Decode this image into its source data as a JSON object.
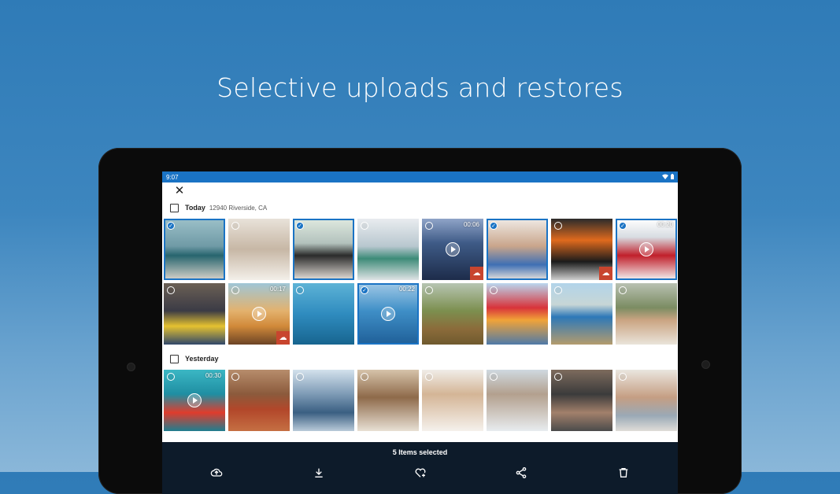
{
  "headline": "Selective uploads and restores",
  "status": {
    "time": "9:07"
  },
  "sections": {
    "today": {
      "title": "Today",
      "subtitle": "12940 Riverside, CA"
    },
    "yesterday": {
      "title": "Yesterday"
    }
  },
  "today_items": [
    {
      "selected": true,
      "duration": ""
    },
    {
      "selected": false,
      "duration": ""
    },
    {
      "selected": true,
      "duration": ""
    },
    {
      "selected": false,
      "duration": ""
    },
    {
      "selected": false,
      "duration": "00:06",
      "cloud_off": true
    },
    {
      "selected": true,
      "duration": ""
    },
    {
      "selected": false,
      "duration": "",
      "cloud_off": true
    },
    {
      "selected": true,
      "duration": "00:20"
    },
    {
      "selected": false,
      "duration": ""
    },
    {
      "selected": false,
      "duration": "00:17",
      "cloud_off": true
    },
    {
      "selected": false,
      "duration": ""
    },
    {
      "selected": true,
      "duration": "00:22"
    },
    {
      "selected": false,
      "duration": ""
    },
    {
      "selected": false,
      "duration": ""
    },
    {
      "selected": false,
      "duration": ""
    },
    {
      "selected": false,
      "duration": ""
    }
  ],
  "yesterday_items": [
    {
      "selected": false,
      "duration": "00:30"
    },
    {
      "selected": false,
      "duration": ""
    },
    {
      "selected": false,
      "duration": ""
    },
    {
      "selected": false,
      "duration": ""
    },
    {
      "selected": false,
      "duration": ""
    },
    {
      "selected": false,
      "duration": ""
    },
    {
      "selected": false,
      "duration": ""
    },
    {
      "selected": false,
      "duration": ""
    }
  ],
  "bottom": {
    "selection_text": "5 Items selected"
  },
  "icons": {
    "close": "close-icon",
    "upload": "cloud-upload-icon",
    "download": "download-icon",
    "favorite": "heart-plus-icon",
    "share": "share-icon",
    "delete": "trash-icon"
  },
  "colors": {
    "accent": "#1a73c4",
    "bottom_bar": "#0d1b2a",
    "cloud_off_badge": "#c8452e"
  }
}
